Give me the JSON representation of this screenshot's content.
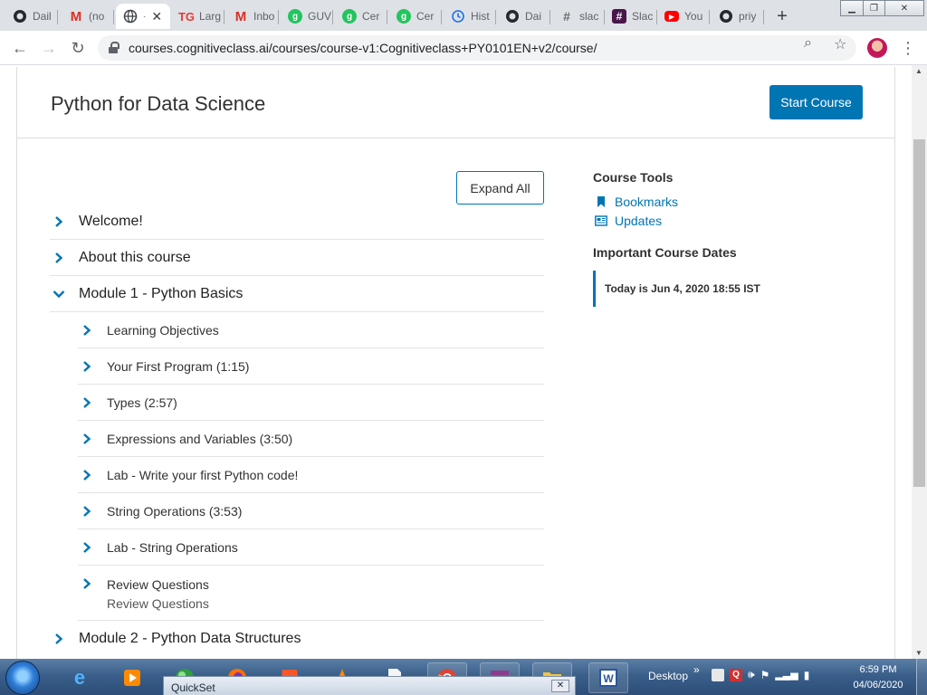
{
  "browser": {
    "tabs": [
      {
        "label": "Dail",
        "icon": "github-icon",
        "color": "#24292e"
      },
      {
        "label": "(no",
        "icon": "gmail-icon",
        "color": "#d93025"
      },
      {
        "label": "",
        "icon": "globe-icon",
        "color": "#5f6368",
        "active": true
      },
      {
        "label": "Larg",
        "icon": "tg-icon",
        "color": "#e53935"
      },
      {
        "label": "Inbo",
        "icon": "gmail-icon",
        "color": "#d93025"
      },
      {
        "label": "GUV",
        "icon": "guvi-icon",
        "color": "#22c55e"
      },
      {
        "label": "Cer",
        "icon": "guvi-icon",
        "color": "#22c55e"
      },
      {
        "label": "Cer",
        "icon": "guvi-icon",
        "color": "#22c55e"
      },
      {
        "label": "Hist",
        "icon": "history-icon",
        "color": "#1a73e8"
      },
      {
        "label": "Dai",
        "icon": "github-icon",
        "color": "#24292e"
      },
      {
        "label": "slac",
        "icon": "slack-icon",
        "color": "#6b6b6b"
      },
      {
        "label": "Slac",
        "icon": "slack-icon",
        "color": "#4a154b"
      },
      {
        "label": "You",
        "icon": "youtube-icon",
        "color": "#ff0000"
      },
      {
        "label": "priy",
        "icon": "github-icon",
        "color": "#24292e"
      }
    ],
    "url": "courses.cognitiveclass.ai/courses/course-v1:Cognitiveclass+PY0101EN+v2/course/"
  },
  "course": {
    "title": "Python for Data Science",
    "start_label": "Start Course",
    "expand_label": "Expand All",
    "sections": [
      {
        "label": "Welcome!",
        "expanded": false
      },
      {
        "label": "About this course",
        "expanded": false
      },
      {
        "label": "Module 1 - Python Basics",
        "expanded": true
      }
    ],
    "subsections": [
      {
        "label": "Learning Objectives"
      },
      {
        "label": "Your First Program (1:15)"
      },
      {
        "label": "Types (2:57)"
      },
      {
        "label": "Expressions and Variables (3:50)"
      },
      {
        "label": "Lab - Write your first Python code!"
      },
      {
        "label": "String Operations (3:53)"
      },
      {
        "label": "Lab - String Operations"
      },
      {
        "label": "Review Questions",
        "sublabel": "Review Questions"
      }
    ],
    "next_section": {
      "label": "Module 2 - Python Data Structures"
    }
  },
  "tools": {
    "heading": "Course Tools",
    "bookmarks": "Bookmarks",
    "updates": "Updates",
    "dates_heading": "Important Course Dates",
    "today": "Today is Jun 4, 2020 18:55 IST"
  },
  "taskbar": {
    "quickset": "QuickSet",
    "desktop": "Desktop",
    "time": "6:59 PM",
    "date": "04/06/2020"
  },
  "colors": {
    "brand": "#0075b4",
    "chevron": "#0075b4"
  }
}
